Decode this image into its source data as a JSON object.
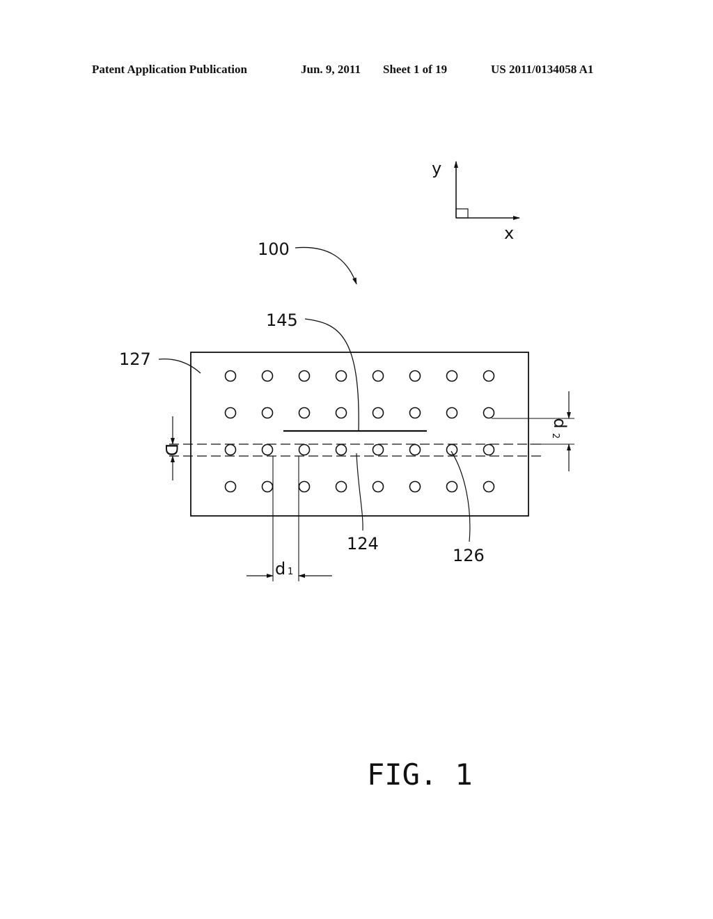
{
  "header": {
    "publication": "Patent Application Publication",
    "date": "Jun. 9, 2011",
    "sheet": "Sheet 1 of 19",
    "number": "US 2011/0134058 A1"
  },
  "figure": {
    "caption": "FIG. 1",
    "axes": {
      "x_label": "x",
      "y_label": "y"
    },
    "reference_labels": {
      "assembly": "100",
      "substrate": "127",
      "line_element": "145",
      "strip": "124",
      "hole": "126"
    },
    "dimensions": {
      "strip_width": "D",
      "hole_pitch_x": "d",
      "hole_pitch_x_sub": "1",
      "row_offset": "d",
      "row_offset_sub": "2"
    },
    "hole_grid": {
      "rows": 4,
      "columns": 8
    }
  }
}
